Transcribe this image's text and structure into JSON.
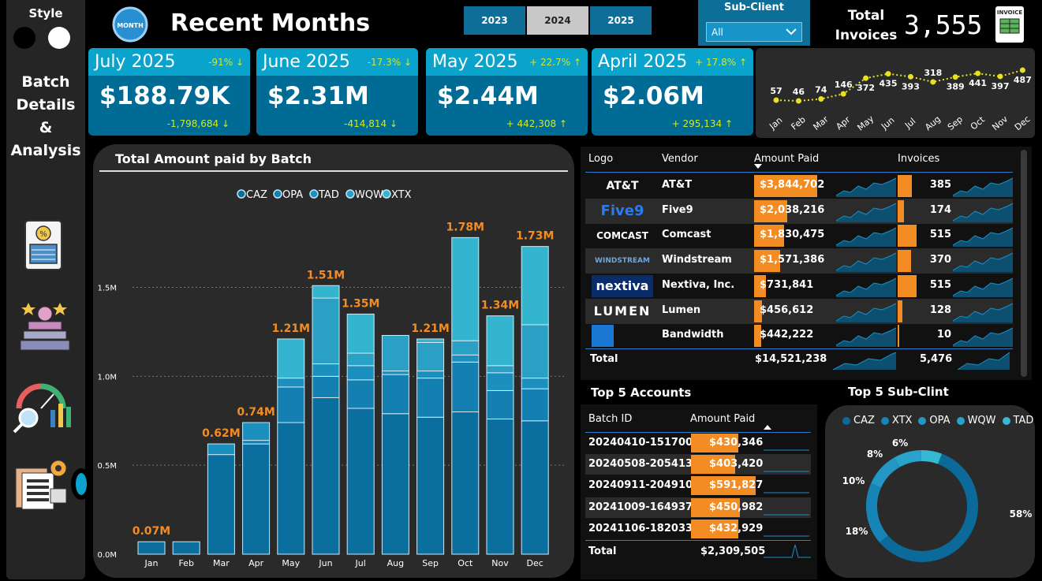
{
  "sidebar": {
    "style_label": "Style",
    "title_lines": [
      "Batch",
      "Details",
      "&",
      "Analysis"
    ]
  },
  "header": {
    "title": "Recent Months",
    "month_badge": "MONTH"
  },
  "years": [
    "2023",
    "2024",
    "2025"
  ],
  "selected_year": "2024",
  "subclient": {
    "label": "Sub-Client",
    "value": "All"
  },
  "total_invoices": {
    "label_lines": [
      "Total",
      "Invoices"
    ],
    "value": "3,555",
    "icon_text": "INVOICE"
  },
  "cards": [
    {
      "month": "July 2025",
      "pct": "-91%",
      "amount": "$188.79K",
      "delta": "-1,798,684",
      "dir": "down"
    },
    {
      "month": "June 2025",
      "pct": "-17.3%",
      "amount": "$2.31M",
      "delta": "-414,814",
      "dir": "down"
    },
    {
      "month": "May 2025",
      "pct": "+ 22.7%",
      "amount": "$2.44M",
      "delta": "+ 442,308",
      "dir": "up"
    },
    {
      "month": "April 2025",
      "pct": "+ 17.8%",
      "amount": "$2.06M",
      "delta": "+ 295,134",
      "dir": "up"
    }
  ],
  "trend": {
    "months": [
      "Jan",
      "Feb",
      "Mar",
      "Apr",
      "May",
      "Jun",
      "Jul",
      "Aug",
      "Sep",
      "Oct",
      "Nov",
      "Dec"
    ],
    "values": [
      57,
      46,
      74,
      146,
      372,
      435,
      393,
      318,
      389,
      441,
      397,
      487
    ],
    "labels": [
      "57",
      "46",
      "74",
      "146",
      "372",
      "435",
      "393",
      "318",
      "389",
      "441",
      "397",
      "487"
    ],
    "color": "#e8e020"
  },
  "chart_data": {
    "type": "bar",
    "title": "Total Amount paid by Batch",
    "categories": [
      "Jan",
      "Feb",
      "Mar",
      "Apr",
      "May",
      "Jun",
      "Jul",
      "Aug",
      "Sep",
      "Oct",
      "Nov",
      "Dec"
    ],
    "series": [
      {
        "name": "CAZ",
        "values": [
          0.07,
          0.07,
          0.56,
          0.62,
          0.74,
          0.88,
          0.82,
          0.79,
          0.77,
          0.8,
          0.76,
          0.75
        ]
      },
      {
        "name": "OPA",
        "values": [
          0,
          0,
          0,
          0.02,
          0.2,
          0.12,
          0.16,
          0.22,
          0.22,
          0.28,
          0.16,
          0.18
        ]
      },
      {
        "name": "TAD",
        "values": [
          0,
          0,
          0.06,
          0.1,
          0.05,
          0.07,
          0.08,
          0.02,
          0.04,
          0.04,
          0.1,
          0.06
        ]
      },
      {
        "name": "WQW",
        "values": [
          0,
          0,
          0,
          0,
          0,
          0.37,
          0.07,
          0.2,
          0.16,
          0.08,
          0.04,
          0.3
        ]
      },
      {
        "name": "XTX",
        "values": [
          0,
          0,
          0,
          0,
          0.22,
          0.07,
          0.22,
          0,
          0.02,
          0.58,
          0.28,
          0.44
        ]
      }
    ],
    "totals": [
      0.07,
      0.07,
      0.62,
      0.74,
      1.21,
      1.51,
      1.35,
      1.23,
      1.21,
      1.78,
      1.34,
      1.73
    ],
    "total_labels": [
      "0.07M",
      "",
      "0.62M",
      "0.74M",
      "1.21M",
      "1.51M",
      "1.35M",
      "",
      "1.21M",
      "1.78M",
      "1.34M",
      "1.73M"
    ],
    "y_ticks": [
      "0.0M",
      "0.5M",
      "1.0M",
      "1.5M"
    ],
    "y_tick_values": [
      0,
      0.5,
      1.0,
      1.5
    ],
    "ylim": [
      0,
      1.95
    ],
    "colors": [
      "#0a6e9e",
      "#1380b1",
      "#1b8fbd",
      "#2aa0c5",
      "#33b5cf"
    ],
    "legend_position": "top-center"
  },
  "vendors": {
    "headers": {
      "logo": "Logo",
      "vendor": "Vendor",
      "amount": "Amount Paid",
      "invoices": "Invoices"
    },
    "rows": [
      {
        "logo": "AT&T",
        "name": "AT&T",
        "amount": "$3,844,702",
        "amt_frac": 1.0,
        "invoices": "385",
        "inv_frac": 0.75
      },
      {
        "logo": "Five9",
        "name": "Five9",
        "amount": "$2,038,216",
        "amt_frac": 0.53,
        "invoices": "174",
        "inv_frac": 0.34
      },
      {
        "logo": "COMCAST",
        "name": "Comcast",
        "amount": "$1,830,475",
        "amt_frac": 0.48,
        "invoices": "515",
        "inv_frac": 1.0
      },
      {
        "logo": "WINDSTREAM",
        "name": "Windstream",
        "amount": "$1,571,386",
        "amt_frac": 0.41,
        "invoices": "370",
        "inv_frac": 0.72
      },
      {
        "logo": "nextiva",
        "name": "Nextiva, Inc.",
        "amount": "$731,841",
        "amt_frac": 0.19,
        "invoices": "515",
        "inv_frac": 1.0
      },
      {
        "logo": "LUMEN",
        "name": "Lumen",
        "amount": "$456,612",
        "amt_frac": 0.12,
        "invoices": "128",
        "inv_frac": 0.25
      },
      {
        "logo": "",
        "name": "Bandwidth",
        "amount": "$442,222",
        "amt_frac": 0.11,
        "invoices": "10",
        "inv_frac": 0.02
      }
    ],
    "total": {
      "label": "Total",
      "amount": "$14,521,238",
      "invoices": "5,476"
    }
  },
  "top5_accounts": {
    "title": "Top 5 Accounts",
    "headers": {
      "batch": "Batch ID",
      "amount": "Amount Paid"
    },
    "rows": [
      {
        "batch": "20240410-151700",
        "amount": "$430,346"
      },
      {
        "batch": "20240508-205413",
        "amount": "$403,420"
      },
      {
        "batch": "20240911-204910",
        "amount": "$591,827"
      },
      {
        "batch": "20241009-164937",
        "amount": "$450,982"
      },
      {
        "batch": "20241106-182033",
        "amount": "$432,929"
      }
    ],
    "total": {
      "label": "Total",
      "amount": "$2,309,505"
    }
  },
  "top5_subclient": {
    "title": "Top 5 Sub-Clint",
    "legend": [
      "CAZ",
      "XTX",
      "OPA",
      "WQW",
      "TAD"
    ],
    "legend_colors": [
      "#0b6a99",
      "#1784b6",
      "#2396c4",
      "#2aa3cc",
      "#36b8d2"
    ],
    "values": [
      58,
      18,
      10,
      8,
      6
    ],
    "labels": [
      "58%",
      "18%",
      "10%",
      "8%",
      "6%"
    ]
  }
}
